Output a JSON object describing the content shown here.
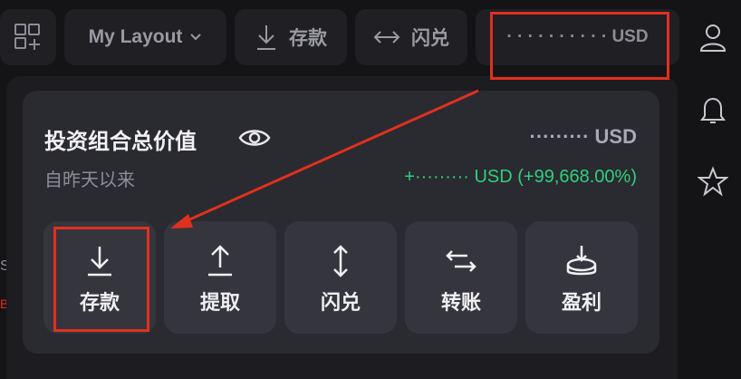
{
  "toolbar": {
    "layout_label": "My Layout",
    "deposit_label": "存款",
    "swap_label": "闪兑",
    "balance_masked": "· · · · · · · · · · USD",
    "icons": [
      "grid-add-icon",
      "chevron-down-icon",
      "download-icon",
      "swap-arrows-icon"
    ]
  },
  "rail": {
    "icons": [
      "user-icon",
      "bell-icon",
      "star-icon"
    ]
  },
  "portfolio": {
    "title": "投资组合总价值",
    "subtitle": "自昨天以来",
    "balance": "········· USD",
    "change": "+········· USD (+99,668.00%)",
    "change_color": "#2fd07a"
  },
  "actions": [
    {
      "label": "存款",
      "icon": "download-icon"
    },
    {
      "label": "提取",
      "icon": "upload-icon"
    },
    {
      "label": "闪兑",
      "icon": "vertical-swap-icon"
    },
    {
      "label": "转账",
      "icon": "transfer-icon"
    },
    {
      "label": "盈利",
      "icon": "earn-icon"
    }
  ],
  "annotation": {
    "color": "#e0301e"
  },
  "edge": {
    "letter_s": "S",
    "letter_b": "B"
  }
}
